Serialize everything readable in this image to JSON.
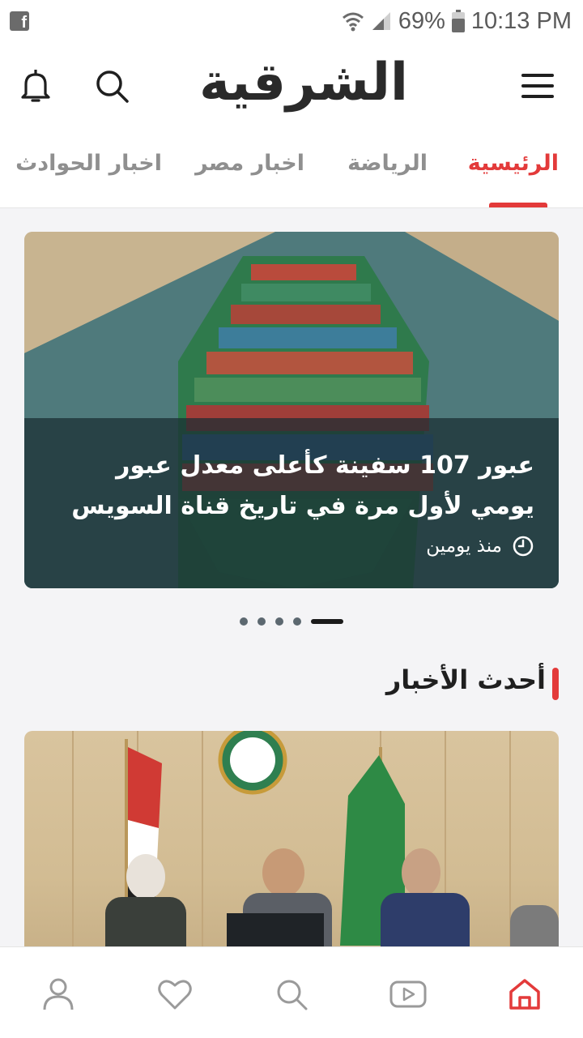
{
  "statusbar": {
    "battery": "69%",
    "time": "10:13 PM"
  },
  "header": {
    "logo_text": "الشرقية"
  },
  "tabs": [
    {
      "label": "الرئيسية",
      "active": true
    },
    {
      "label": "الرياضة",
      "active": false
    },
    {
      "label": "اخبار مصر",
      "active": false
    },
    {
      "label": "اخبار الحوادث",
      "active": false
    }
  ],
  "hero": {
    "title": "عبور 107 سفينة كأعلى معدل عبور يومي لأول مرة في تاريخ قناة السويس",
    "time": "منذ يومين"
  },
  "carousel": {
    "total": 5,
    "active_index": 0
  },
  "latest": {
    "section_title": "أحدث الأخبار"
  },
  "colors": {
    "accent": "#e33a3a",
    "text": "#1f1f1f",
    "muted": "#8f8f8f"
  },
  "icons": {
    "header_left": [
      "bell-icon",
      "search-icon"
    ],
    "header_right": "menu-icon",
    "bottom_nav": [
      "profile-icon",
      "heart-icon",
      "search-icon",
      "video-icon",
      "home-icon"
    ]
  }
}
